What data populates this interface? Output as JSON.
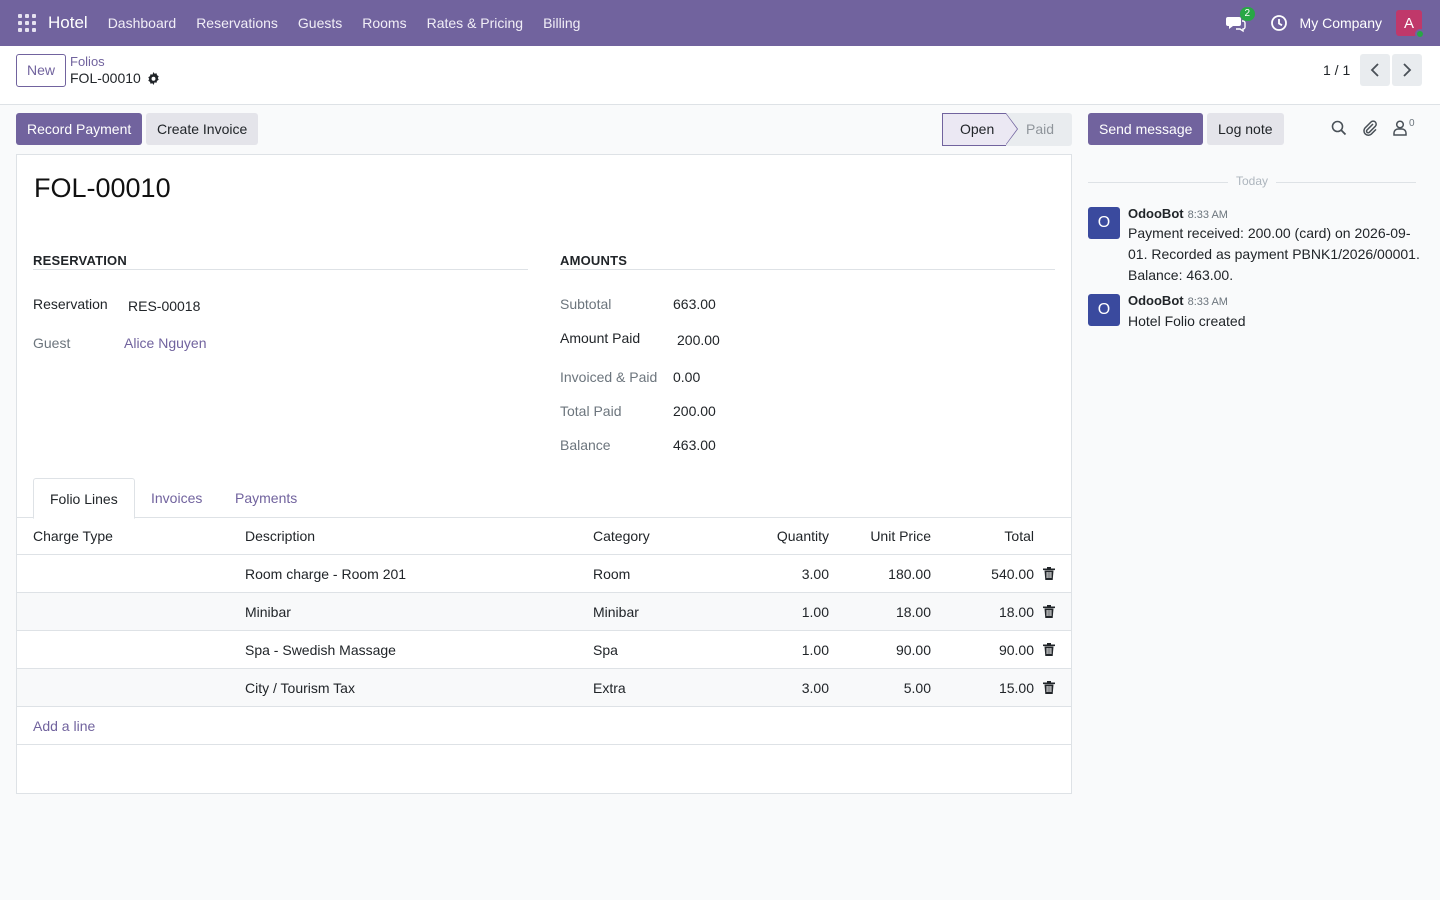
{
  "navbar": {
    "brand": "Hotel",
    "menu": [
      "Dashboard",
      "Reservations",
      "Guests",
      "Rooms",
      "Rates & Pricing",
      "Billing"
    ],
    "chat_count": "2",
    "company": "My Company",
    "avatar_letter": "A",
    "avatar_color": "#c0386a",
    "bar_color": "#71639e"
  },
  "control": {
    "new_label": "New",
    "breadcrumb_parent": "Folios",
    "breadcrumb_current": "FOL-00010",
    "pager": "1 / 1"
  },
  "actions": {
    "record_payment": "Record Payment",
    "create_invoice": "Create Invoice"
  },
  "status": {
    "stages": [
      "Open",
      "Paid"
    ],
    "current": "Open"
  },
  "form": {
    "title": "FOL-00010",
    "reservation_group": {
      "title": "RESERVATION",
      "reservation_label": "Reservation",
      "reservation_value": "RES-00018",
      "guest_label": "Guest",
      "guest_value": "Alice Nguyen"
    },
    "amounts_group": {
      "title": "AMOUNTS",
      "subtotal_label": "Subtotal",
      "subtotal_value": "663.00",
      "amount_paid_label": "Amount Paid",
      "amount_paid_value": "200.00",
      "invoiced_paid_label": "Invoiced & Paid",
      "invoiced_paid_value": "0.00",
      "total_paid_label": "Total Paid",
      "total_paid_value": "200.00",
      "balance_label": "Balance",
      "balance_value": "463.00"
    },
    "tabs": [
      "Folio Lines",
      "Invoices",
      "Payments"
    ],
    "table": {
      "headers": [
        "Charge Type",
        "Description",
        "Category",
        "Quantity",
        "Unit Price",
        "Total"
      ],
      "rows": [
        {
          "charge_type": "",
          "description": "Room charge - Room 201",
          "category": "Room",
          "quantity": "3.00",
          "unit_price": "180.00",
          "total": "540.00"
        },
        {
          "charge_type": "",
          "description": "Minibar",
          "category": "Minibar",
          "quantity": "1.00",
          "unit_price": "18.00",
          "total": "18.00"
        },
        {
          "charge_type": "",
          "description": "Spa - Swedish Massage",
          "category": "Spa",
          "quantity": "1.00",
          "unit_price": "90.00",
          "total": "90.00"
        },
        {
          "charge_type": "",
          "description": "City / Tourism Tax",
          "category": "Extra",
          "quantity": "3.00",
          "unit_price": "5.00",
          "total": "15.00"
        }
      ],
      "add_line": "Add a line"
    }
  },
  "chatter": {
    "send_message": "Send message",
    "log_note": "Log note",
    "follower_count": "0",
    "today": "Today",
    "messages": [
      {
        "avatar": "O",
        "author": "OdooBot",
        "time": "8:33 AM",
        "body": "Payment received: 200.00 (card) on 2026-09-01. Recorded as payment PBNK1/2026/00001. Balance: 463.00."
      },
      {
        "avatar": "O",
        "author": "OdooBot",
        "time": "8:33 AM",
        "body": "Hotel Folio created"
      }
    ]
  }
}
